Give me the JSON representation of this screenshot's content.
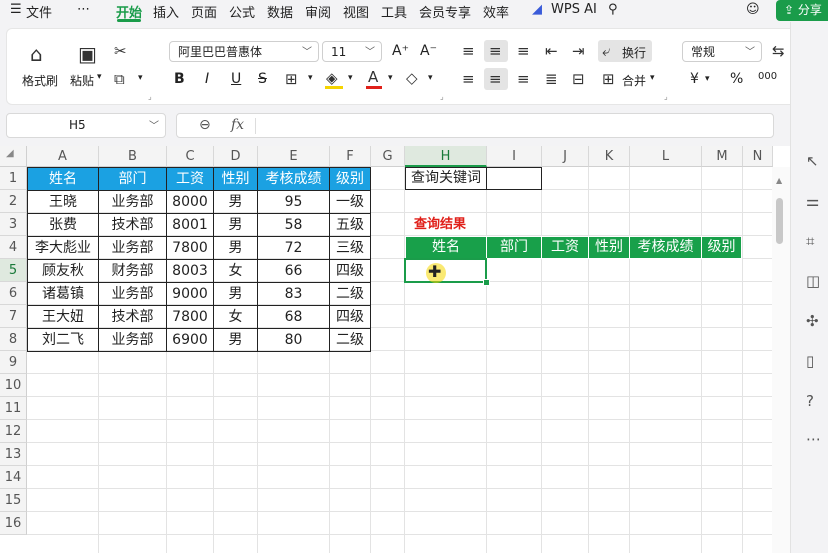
{
  "menu": {
    "file": "文件",
    "more": "⋯",
    "tabs": [
      "开始",
      "插入",
      "页面",
      "公式",
      "数据",
      "审阅",
      "视图",
      "工具",
      "会员专享",
      "效率"
    ],
    "ai": "WPS AI",
    "share": "分享"
  },
  "ribbon": {
    "format_painter": "格式刷",
    "paste": "粘贴",
    "font_name": "阿里巴巴普惠体",
    "font_size": "11",
    "wrap": "换行",
    "number_format": "常规",
    "merge": "合并",
    "bold": "B",
    "italic": "I",
    "underline": "U",
    "strike": "S",
    "font_grow": "A⁺",
    "font_shrink": "A⁻",
    "currency": "¥",
    "percent": "%",
    "thousands": "000",
    "convert": "转"
  },
  "formula_bar": {
    "cell_ref": "H5",
    "fx": "fx",
    "value": ""
  },
  "columns": [
    "A",
    "B",
    "C",
    "D",
    "E",
    "F",
    "G",
    "H",
    "I",
    "J",
    "K",
    "L",
    "M",
    "N"
  ],
  "rows": [
    "1",
    "2",
    "3",
    "4",
    "5",
    "6",
    "7",
    "8",
    "9",
    "10",
    "11",
    "12",
    "13",
    "14",
    "15",
    "16"
  ],
  "source_table": {
    "headers": [
      "姓名",
      "部门",
      "工资",
      "性别",
      "考核成绩",
      "级别"
    ],
    "rows": [
      [
        "王晓",
        "业务部",
        "8000",
        "男",
        "95",
        "一级"
      ],
      [
        "张费",
        "技术部",
        "8001",
        "男",
        "58",
        "五级"
      ],
      [
        "李大彪业",
        "业务部",
        "7800",
        "男",
        "72",
        "三级"
      ],
      [
        "顾友秋",
        "财务部",
        "8003",
        "女",
        "66",
        "四级"
      ],
      [
        "诸葛镇",
        "业务部",
        "9000",
        "男",
        "83",
        "二级"
      ],
      [
        "王大妞",
        "技术部",
        "7800",
        "女",
        "68",
        "四级"
      ],
      [
        "刘二飞",
        "业务部",
        "6900",
        "男",
        "80",
        "二级"
      ]
    ]
  },
  "query": {
    "keyword_label": "查询关键词",
    "result_title": "查询结果",
    "result_headers": [
      "姓名",
      "部门",
      "工资",
      "性别",
      "考核成绩",
      "级别"
    ]
  },
  "colors": {
    "accent": "#1a9c4a",
    "blue_header": "#1ba1e2",
    "green_header": "#18a04a",
    "result_title": "#e0201a"
  }
}
